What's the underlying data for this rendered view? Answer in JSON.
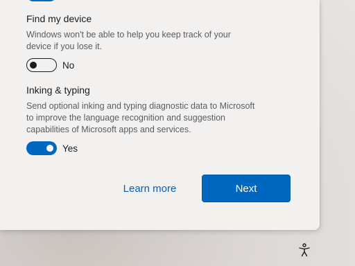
{
  "settings": {
    "find_my_device": {
      "title": "Find my device",
      "description": "Windows won't be able to help you keep track of your device if you lose it.",
      "state": "No"
    },
    "inking_typing": {
      "title": "Inking & typing",
      "description": "Send optional inking and typing diagnostic data to Microsoft to improve the language recognition and suggestion capabilities of Microsoft apps and services.",
      "state": "Yes"
    }
  },
  "footer": {
    "learn_more_label": "Learn more",
    "next_label": "Next"
  },
  "icons": {
    "accessibility": "accessibility-icon"
  },
  "colors": {
    "accent": "#0067c0",
    "link": "#0a5dab",
    "dialog_background": "#f3f1f0"
  }
}
